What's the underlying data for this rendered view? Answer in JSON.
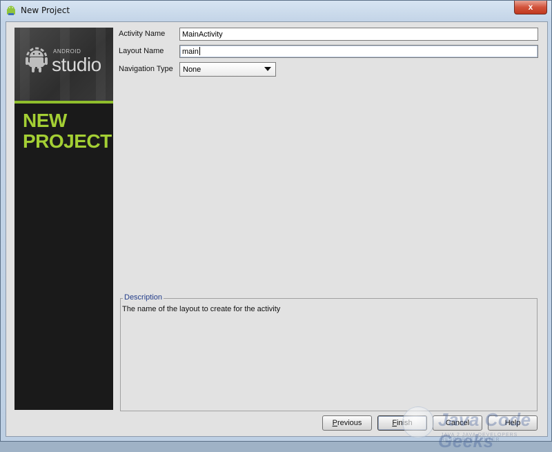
{
  "window": {
    "title": "New Project",
    "close_label": "x"
  },
  "sidebar": {
    "logo_small": "ANDROID",
    "logo_large": "studio",
    "heading_line1": "NEW",
    "heading_line2": "PROJECT",
    "accent_color": "#a4cf34"
  },
  "form": {
    "activity_name_label": "Activity Name",
    "activity_name_value": "MainActivity",
    "layout_name_label": "Layout Name",
    "layout_name_value": "main",
    "navigation_type_label": "Navigation Type",
    "navigation_type_value": "None"
  },
  "description": {
    "legend": "Description",
    "text": "The name of the layout to create for the activity"
  },
  "buttons": {
    "previous": {
      "mnemonic": "P",
      "rest": "revious"
    },
    "finish": {
      "mnemonic": "F",
      "rest": "inish"
    },
    "cancel": "Cancel",
    "help": "Help"
  },
  "watermark": {
    "text": "Java Code Geeks",
    "sub": "JAVA 2 JAVA DEVELOPERS RESOURCE CENTER"
  }
}
